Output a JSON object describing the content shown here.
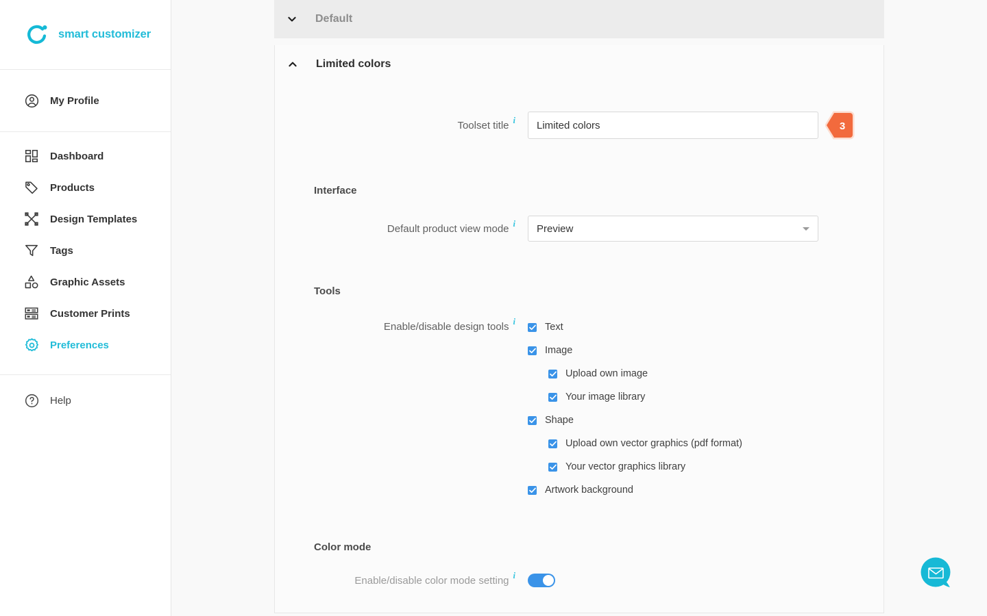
{
  "brand": {
    "name": "smart customizer",
    "accent_color": "#22bcd8",
    "logo_icon": "ring-dot-logo-icon"
  },
  "sidebar": {
    "groups": [
      {
        "items": [
          {
            "label": "My Profile",
            "icon": "user-circle-icon",
            "active": false
          }
        ]
      },
      {
        "items": [
          {
            "label": "Dashboard",
            "icon": "dashboard-grid-icon",
            "active": false
          },
          {
            "label": "Products",
            "icon": "tag-icon",
            "active": false
          },
          {
            "label": "Design Templates",
            "icon": "design-templates-icon",
            "active": false
          },
          {
            "label": "Tags",
            "icon": "filter-funnel-icon",
            "active": false
          },
          {
            "label": "Graphic Assets",
            "icon": "shapes-icon",
            "active": false
          },
          {
            "label": "Customer Prints",
            "icon": "prints-icon",
            "active": false
          },
          {
            "label": "Preferences",
            "icon": "gear-icon",
            "active": true
          }
        ]
      },
      {
        "items": [
          {
            "label": "Help",
            "icon": "question-circle-icon",
            "active": false
          }
        ]
      }
    ]
  },
  "main": {
    "collapsed_panel": {
      "title": "Default",
      "chevron": "chevron-down-icon",
      "expanded": false
    },
    "open_panel": {
      "title": "Limited colors",
      "chevron": "chevron-up-icon",
      "expanded": true,
      "toolset_title_field": {
        "label": "Toolset title",
        "value": "Limited colors",
        "info_icon": "info-icon",
        "badge": {
          "text": "3",
          "color": "#f26a3d"
        }
      },
      "interface_section": {
        "title": "Interface",
        "view_mode_field": {
          "label": "Default product view mode",
          "value": "Preview",
          "info_icon": "info-icon",
          "arrow_icon": "chevron-down-icon"
        }
      },
      "tools_section": {
        "title": "Tools",
        "tools_field_label": "Enable/disable design tools",
        "info_icon": "info-icon",
        "checkbox_color": "#3a93e8",
        "items": [
          {
            "label": "Text",
            "checked": true,
            "indent": 0
          },
          {
            "label": "Image",
            "checked": true,
            "indent": 0
          },
          {
            "label": "Upload own image",
            "checked": true,
            "indent": 1
          },
          {
            "label": "Your image library",
            "checked": true,
            "indent": 1
          },
          {
            "label": "Shape",
            "checked": true,
            "indent": 0
          },
          {
            "label": "Upload own vector graphics (pdf format)",
            "checked": true,
            "indent": 1
          },
          {
            "label": "Your vector graphics library",
            "checked": true,
            "indent": 1
          },
          {
            "label": "Artwork background",
            "checked": true,
            "indent": 0
          }
        ]
      },
      "color_mode_section": {
        "title": "Color mode",
        "cut_off_row_label": "Enable/disable color mode setting"
      }
    }
  },
  "chat_widget": {
    "icon": "envelope-chat-icon",
    "color": "#17b9d6"
  }
}
